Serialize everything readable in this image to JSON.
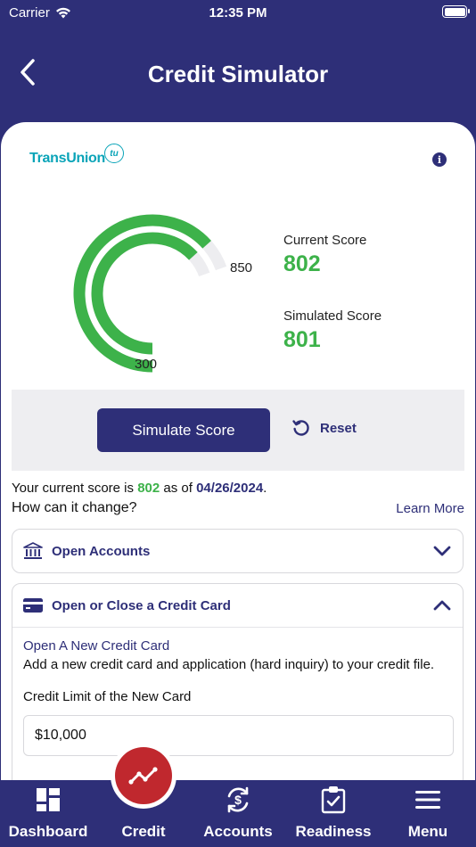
{
  "status_bar": {
    "carrier": "Carrier",
    "time": "12:35 PM"
  },
  "nav": {
    "title": "Credit Simulator",
    "back_icon": "chevron-left-icon"
  },
  "brand": {
    "name": "TransUnion",
    "badge": "tu",
    "color": "#0aa4b8"
  },
  "gauge": {
    "min_label": "300",
    "max_label": "850",
    "min": 300,
    "max": 850,
    "current": 802,
    "simulated": 801,
    "color": "#3db24a",
    "track_color": "#ededf0"
  },
  "scores": {
    "current_label": "Current Score",
    "current_value": "802",
    "simulated_label": "Simulated Score",
    "simulated_value": "801"
  },
  "actions": {
    "simulate_label": "Simulate Score",
    "reset_label": "Reset"
  },
  "summary": {
    "prefix": "Your current score is",
    "score": "802",
    "middle": "as of",
    "date": "04/26/2024",
    "suffix": ".",
    "question": "How can it change?",
    "learn_more": "Learn More"
  },
  "accordions": [
    {
      "label": "Open Accounts",
      "icon": "bank-icon",
      "expanded": false
    },
    {
      "label": "Open or Close a Credit Card",
      "icon": "credit-card-icon",
      "expanded": true,
      "content": {
        "title": "Open A New Credit Card",
        "description": "Add a new credit card and application (hard inquiry) to your credit file.",
        "field_label": "Credit Limit of the New Card",
        "field_value": "$10,000"
      }
    }
  ],
  "tabs": [
    {
      "label": "Dashboard",
      "icon": "dashboard-grid-icon"
    },
    {
      "label": "Credit",
      "icon": "trend-line-icon",
      "active": true
    },
    {
      "label": "Accounts",
      "icon": "dollar-exchange-icon"
    },
    {
      "label": "Readiness",
      "icon": "clipboard-check-icon"
    },
    {
      "label": "Menu",
      "icon": "hamburger-menu-icon"
    }
  ],
  "colors": {
    "primary": "#2e2f78",
    "accent_green": "#3db24a",
    "fab_red": "#c0282e"
  }
}
